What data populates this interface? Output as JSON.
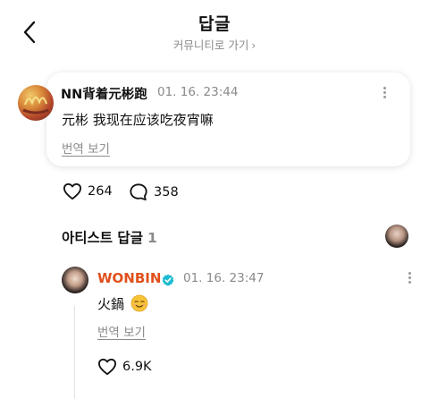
{
  "header": {
    "title": "답글",
    "community_link": "커뮤니티로 가기"
  },
  "post": {
    "author": "NN背着元彬跑",
    "time": "01. 16. 23:44",
    "text": "元彬 我现在应该吃夜宵嘛",
    "translate_label": "번역 보기",
    "likes": "264",
    "comments": "358"
  },
  "artist_section": {
    "title": "아티스트 답글",
    "count": "1"
  },
  "artist_reply": {
    "author": "WONBIN",
    "time": "01. 16. 23:47",
    "text": "火鍋",
    "emoji": "☺",
    "translate_label": "번역 보기",
    "likes": "6.9K"
  },
  "colors": {
    "artist_name": "#e0501b",
    "verified_badge": "#1fbcd2",
    "muted_text": "#8a8a8a"
  },
  "icons": [
    "back-arrow-icon",
    "chevron-right-icon",
    "more-vertical-icon",
    "heart-icon",
    "comment-icon",
    "verified-badge-icon"
  ]
}
